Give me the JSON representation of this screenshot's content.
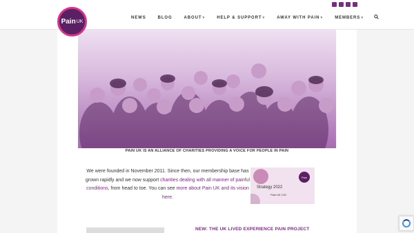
{
  "brand": {
    "name": "Pain",
    "suffix": "UK",
    "primary_color": "#7a2b82",
    "accent_color": "#d4358a"
  },
  "social_icons": [
    "facebook-icon",
    "twitter-icon",
    "youtube-icon",
    "instagram-icon"
  ],
  "nav": {
    "items": [
      {
        "label": "NEWS",
        "dropdown": false
      },
      {
        "label": "BLOG",
        "dropdown": false
      },
      {
        "label": "ABOUT",
        "dropdown": true
      },
      {
        "label": "HELP & SUPPORT",
        "dropdown": true
      },
      {
        "label": "AWAY WITH PAIN",
        "dropdown": true
      },
      {
        "label": "MEMBERS",
        "dropdown": true
      }
    ],
    "caret": "˅",
    "search_icon": "search-icon"
  },
  "hero": {
    "caption": "PAIN UK IS AN ALLIANCE OF CHARITIES PROVIDING A VOICE FOR PEOPLE IN PAIN"
  },
  "intro": {
    "text1": "We were founded in November 2011. Since then, our membership base has grown rapidly and we now support ",
    "link1": "charities dealing with all manner of painful conditions",
    "text2": ", from head to toe. You can see ",
    "link2": "more about Pain UK and its vision here",
    "text3": "."
  },
  "strategy": {
    "title": "Strategy 2022",
    "subtitle": "Pain UK CIO",
    "badge": "Pain"
  },
  "project": {
    "heading": "NEW: THE UK LIVED EXPERIENCE PAIN PROJECT"
  }
}
